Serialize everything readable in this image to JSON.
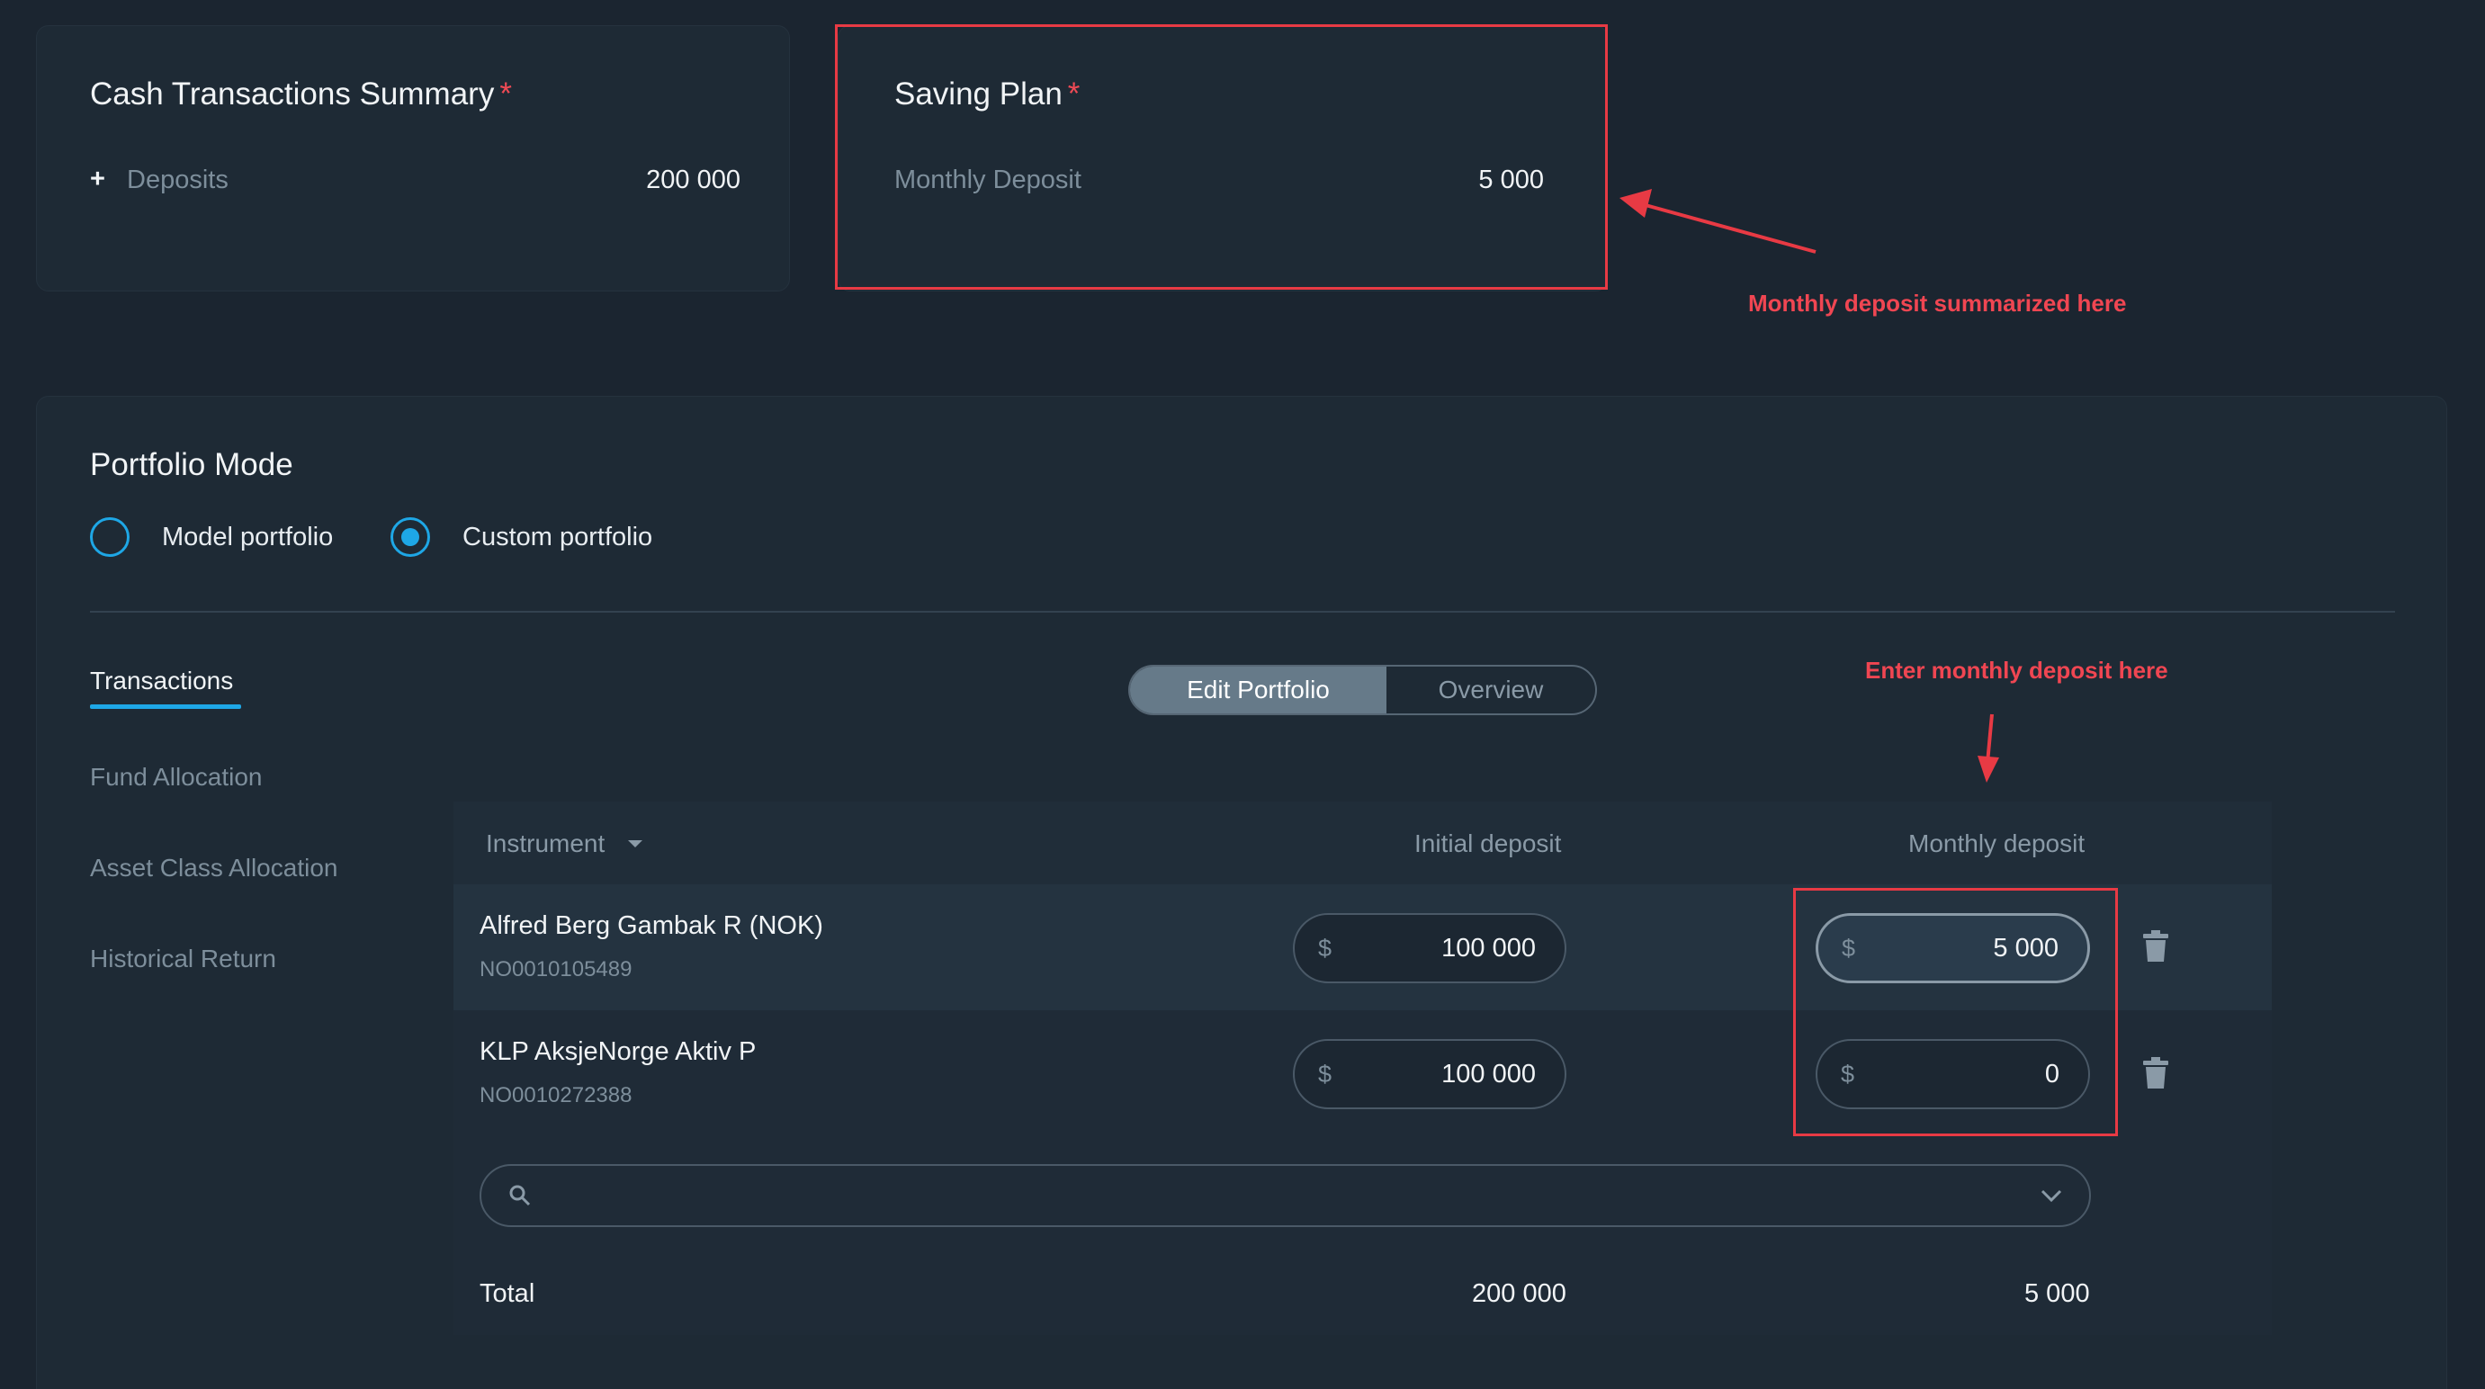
{
  "cash_summary": {
    "title": "Cash Transactions Summary",
    "required_mark": "*",
    "deposits_label": "Deposits",
    "deposits_value": "200 000",
    "plus_symbol": "+"
  },
  "saving_plan": {
    "title": "Saving Plan",
    "required_mark": "*",
    "monthly_label": "Monthly Deposit",
    "monthly_value": "5 000"
  },
  "annotations": {
    "summary_note": "Monthly deposit summarized here",
    "enter_note": "Enter monthly deposit here",
    "highlight_color": "#e83a44"
  },
  "portfolio_mode": {
    "title": "Portfolio Mode",
    "options": [
      {
        "label": "Model portfolio",
        "selected": false
      },
      {
        "label": "Custom portfolio",
        "selected": true
      }
    ]
  },
  "sidebar": {
    "items": [
      {
        "label": "Transactions",
        "active": true
      },
      {
        "label": "Fund Allocation",
        "active": false
      },
      {
        "label": "Asset Class Allocation",
        "active": false
      },
      {
        "label": "Historical Return",
        "active": false
      }
    ]
  },
  "view_toggle": {
    "options": [
      "Edit Portfolio",
      "Overview"
    ],
    "selected": "Edit Portfolio"
  },
  "table": {
    "headers": {
      "instrument": "Instrument",
      "initial": "Initial deposit",
      "monthly": "Monthly deposit"
    },
    "currency_symbol": "$",
    "rows": [
      {
        "name": "Alfred Berg Gambak R (NOK)",
        "isin": "NO0010105489",
        "initial": "100 000",
        "monthly": "5 000"
      },
      {
        "name": "KLP AksjeNorge Aktiv P",
        "isin": "NO0010272388",
        "initial": "100 000",
        "monthly": "0"
      }
    ],
    "search_placeholder": "",
    "total": {
      "label": "Total",
      "initial": "200 000",
      "monthly": "5 000"
    }
  },
  "colors": {
    "background": "#1b2530",
    "card": "#1e2a35",
    "accent": "#1ea7e6",
    "required": "#ef4a55"
  }
}
